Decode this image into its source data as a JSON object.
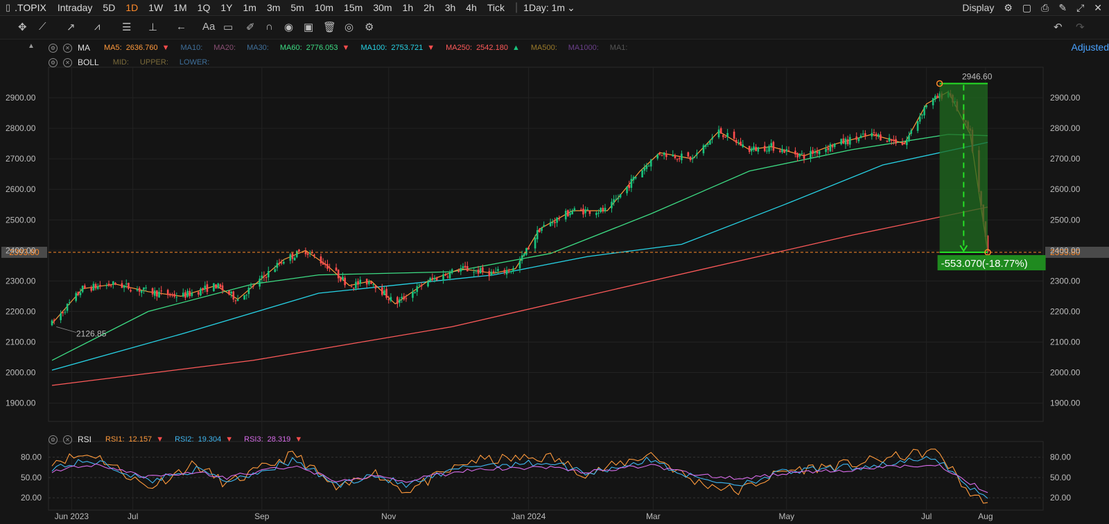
{
  "header": {
    "symbol": ".TOPIX",
    "timeframes": [
      "Intraday",
      "5D",
      "1D",
      "1W",
      "1M",
      "1Q",
      "1Y",
      "1m",
      "3m",
      "5m",
      "10m",
      "15m",
      "30m",
      "1h",
      "2h",
      "3h",
      "4h",
      "Tick"
    ],
    "active_timeframe": "1D",
    "interval_select": "1Day: 1m",
    "display_label": "Display",
    "adjusted_label": "Adjusted"
  },
  "indicators": {
    "ma_name": "MA",
    "ma_items": [
      {
        "label": "MA5:",
        "value": "2636.760",
        "color": "#ff9a3c",
        "arrow": "▼",
        "arrow_dir": "down"
      },
      {
        "label": "MA10:",
        "value": "",
        "color": "#3f6f9a",
        "arrow": "",
        "arrow_dir": ""
      },
      {
        "label": "MA20:",
        "value": "",
        "color": "#8a4f74",
        "arrow": "",
        "arrow_dir": ""
      },
      {
        "label": "MA30:",
        "value": "",
        "color": "#3f6f9a",
        "arrow": "",
        "arrow_dir": ""
      },
      {
        "label": "MA60:",
        "value": "2776.053",
        "color": "#3ddc84",
        "arrow": "▼",
        "arrow_dir": "down"
      },
      {
        "label": "MA100:",
        "value": "2753.721",
        "color": "#27d3e6",
        "arrow": "▼",
        "arrow_dir": "down"
      },
      {
        "label": "MA250:",
        "value": "2542.180",
        "color": "#ff5a5a",
        "arrow": "▲",
        "arrow_dir": "up"
      },
      {
        "label": "MA500:",
        "value": "",
        "color": "#9a7a2a",
        "arrow": "",
        "arrow_dir": ""
      },
      {
        "label": "MA1000:",
        "value": "",
        "color": "#6a3f8a",
        "arrow": "",
        "arrow_dir": ""
      },
      {
        "label": "MA1:",
        "value": "",
        "color": "#555555",
        "arrow": "",
        "arrow_dir": ""
      }
    ],
    "boll_name": "BOLL",
    "boll_items": [
      {
        "label": "MID:",
        "color": "#7a6a3a"
      },
      {
        "label": "UPPER:",
        "color": "#7a6a3a"
      },
      {
        "label": "LOWER:",
        "color": "#3f6f9a"
      }
    ],
    "rsi_name": "RSI",
    "rsi_items": [
      {
        "label": "RSI1:",
        "value": "12.157",
        "color": "#ff9a3c"
      },
      {
        "label": "RSI2:",
        "value": "19.304",
        "color": "#3fb6f0"
      },
      {
        "label": "RSI3:",
        "value": "28.319",
        "color": "#d66be8"
      }
    ]
  },
  "chart_data": [
    {
      "type": "candlestick",
      "title": "",
      "x_ticks": [
        "Jun 2023",
        "Jul",
        "Sep",
        "Nov",
        "Jan 2024",
        "Mar",
        "May",
        "Jul",
        "Aug"
      ],
      "y_ticks": [
        "1900.00",
        "2000.00",
        "2100.00",
        "2200.00",
        "2300.00",
        "2400.00",
        "2500.00",
        "2600.00",
        "2700.00",
        "2800.00",
        "2900.00"
      ],
      "ylim": [
        1840,
        3000
      ],
      "current_price_label": "2393.80",
      "low_annotation": "2126.85",
      "high_annotation": "2946.60",
      "measure_label": "-553.070(-18.77%)",
      "close_path": [
        [
          "2023-06-01",
          2160
        ],
        [
          "2023-06-15",
          2275
        ],
        [
          "2023-06-30",
          2290
        ],
        [
          "2023-07-15",
          2265
        ],
        [
          "2023-07-30",
          2250
        ],
        [
          "2023-08-15",
          2285
        ],
        [
          "2023-08-25",
          2240
        ],
        [
          "2023-09-15",
          2370
        ],
        [
          "2023-09-25",
          2400
        ],
        [
          "2023-10-05",
          2350
        ],
        [
          "2023-10-15",
          2285
        ],
        [
          "2023-10-25",
          2300
        ],
        [
          "2023-11-05",
          2225
        ],
        [
          "2023-11-20",
          2300
        ],
        [
          "2023-12-05",
          2340
        ],
        [
          "2023-12-20",
          2325
        ],
        [
          "2023-12-30",
          2340
        ],
        [
          "2024-01-10",
          2470
        ],
        [
          "2024-01-25",
          2530
        ],
        [
          "2024-02-10",
          2530
        ],
        [
          "2024-02-25",
          2660
        ],
        [
          "2024-03-05",
          2720
        ],
        [
          "2024-03-20",
          2700
        ],
        [
          "2024-04-01",
          2790
        ],
        [
          "2024-04-15",
          2730
        ],
        [
          "2024-04-25",
          2740
        ],
        [
          "2024-05-10",
          2710
        ],
        [
          "2024-05-25",
          2750
        ],
        [
          "2024-06-10",
          2780
        ],
        [
          "2024-06-25",
          2750
        ],
        [
          "2024-07-05",
          2880
        ],
        [
          "2024-07-15",
          2920
        ],
        [
          "2024-07-25",
          2780
        ],
        [
          "2024-08-02",
          2394
        ]
      ],
      "ma_series": [
        {
          "name": "MA60",
          "color": "#3ddc84",
          "points": [
            [
              "2023-06-01",
              2040
            ],
            [
              "2023-07-15",
              2200
            ],
            [
              "2023-09-01",
              2290
            ],
            [
              "2023-10-01",
              2320
            ],
            [
              "2023-12-01",
              2330
            ],
            [
              "2024-01-15",
              2390
            ],
            [
              "2024-03-01",
              2520
            ],
            [
              "2024-04-15",
              2660
            ],
            [
              "2024-06-01",
              2730
            ],
            [
              "2024-07-15",
              2780
            ],
            [
              "2024-08-02",
              2776
            ]
          ]
        },
        {
          "name": "MA100",
          "color": "#27d3e6",
          "points": [
            [
              "2023-06-01",
              2008
            ],
            [
              "2023-08-01",
              2130
            ],
            [
              "2023-10-01",
              2260
            ],
            [
              "2023-12-20",
              2320
            ],
            [
              "2024-02-01",
              2380
            ],
            [
              "2024-03-15",
              2420
            ],
            [
              "2024-05-01",
              2550
            ],
            [
              "2024-06-15",
              2680
            ],
            [
              "2024-08-02",
              2754
            ]
          ]
        },
        {
          "name": "MA250",
          "color": "#ff5a5a",
          "points": [
            [
              "2023-06-01",
              1958
            ],
            [
              "2023-09-01",
              2040
            ],
            [
              "2023-12-01",
              2150
            ],
            [
              "2024-03-01",
              2300
            ],
            [
              "2024-06-01",
              2450
            ],
            [
              "2024-08-02",
              2542
            ]
          ]
        }
      ]
    },
    {
      "type": "line",
      "title": "",
      "y_ticks": [
        "20.00",
        "50.00",
        "80.00"
      ],
      "ylim": [
        10,
        95
      ],
      "series": [
        {
          "name": "RSI1",
          "color": "#ff9a3c",
          "points": [
            [
              "2023-06-01",
              75
            ],
            [
              "2023-06-20",
              85
            ],
            [
              "2023-07-15",
              35
            ],
            [
              "2023-08-05",
              70
            ],
            [
              "2023-08-20",
              40
            ],
            [
              "2023-09-20",
              85
            ],
            [
              "2023-10-10",
              30
            ],
            [
              "2023-10-25",
              60
            ],
            [
              "2023-11-10",
              30
            ],
            [
              "2023-12-10",
              75
            ],
            [
              "2024-01-15",
              80
            ],
            [
              "2024-02-01",
              55
            ],
            [
              "2024-03-01",
              85
            ],
            [
              "2024-03-20",
              45
            ],
            [
              "2024-04-10",
              30
            ],
            [
              "2024-05-01",
              60
            ],
            [
              "2024-06-01",
              70
            ],
            [
              "2024-07-10",
              90
            ],
            [
              "2024-07-25",
              25
            ],
            [
              "2024-08-02",
              12
            ]
          ]
        },
        {
          "name": "RSI2",
          "color": "#3fb6f0",
          "points": [
            [
              "2023-06-01",
              65
            ],
            [
              "2023-06-20",
              75
            ],
            [
              "2023-07-15",
              45
            ],
            [
              "2023-08-05",
              62
            ],
            [
              "2023-08-20",
              45
            ],
            [
              "2023-09-20",
              75
            ],
            [
              "2023-10-10",
              38
            ],
            [
              "2023-10-25",
              55
            ],
            [
              "2023-11-10",
              38
            ],
            [
              "2023-12-10",
              68
            ],
            [
              "2024-01-15",
              72
            ],
            [
              "2024-02-01",
              57
            ],
            [
              "2024-03-01",
              76
            ],
            [
              "2024-03-20",
              50
            ],
            [
              "2024-04-10",
              40
            ],
            [
              "2024-05-01",
              58
            ],
            [
              "2024-06-01",
              65
            ],
            [
              "2024-07-10",
              78
            ],
            [
              "2024-07-25",
              35
            ],
            [
              "2024-08-02",
              19
            ]
          ]
        },
        {
          "name": "RSI3",
          "color": "#d66be8",
          "points": [
            [
              "2023-06-01",
              60
            ],
            [
              "2023-06-20",
              68
            ],
            [
              "2023-07-15",
              50
            ],
            [
              "2023-08-05",
              58
            ],
            [
              "2023-08-20",
              50
            ],
            [
              "2023-09-20",
              68
            ],
            [
              "2023-10-10",
              45
            ],
            [
              "2023-10-25",
              52
            ],
            [
              "2023-11-10",
              45
            ],
            [
              "2023-12-10",
              62
            ],
            [
              "2024-01-15",
              66
            ],
            [
              "2024-02-01",
              58
            ],
            [
              "2024-03-01",
              68
            ],
            [
              "2024-03-20",
              55
            ],
            [
              "2024-04-10",
              48
            ],
            [
              "2024-05-01",
              56
            ],
            [
              "2024-06-01",
              62
            ],
            [
              "2024-07-10",
              70
            ],
            [
              "2024-07-25",
              42
            ],
            [
              "2024-08-02",
              28
            ]
          ]
        }
      ]
    }
  ]
}
